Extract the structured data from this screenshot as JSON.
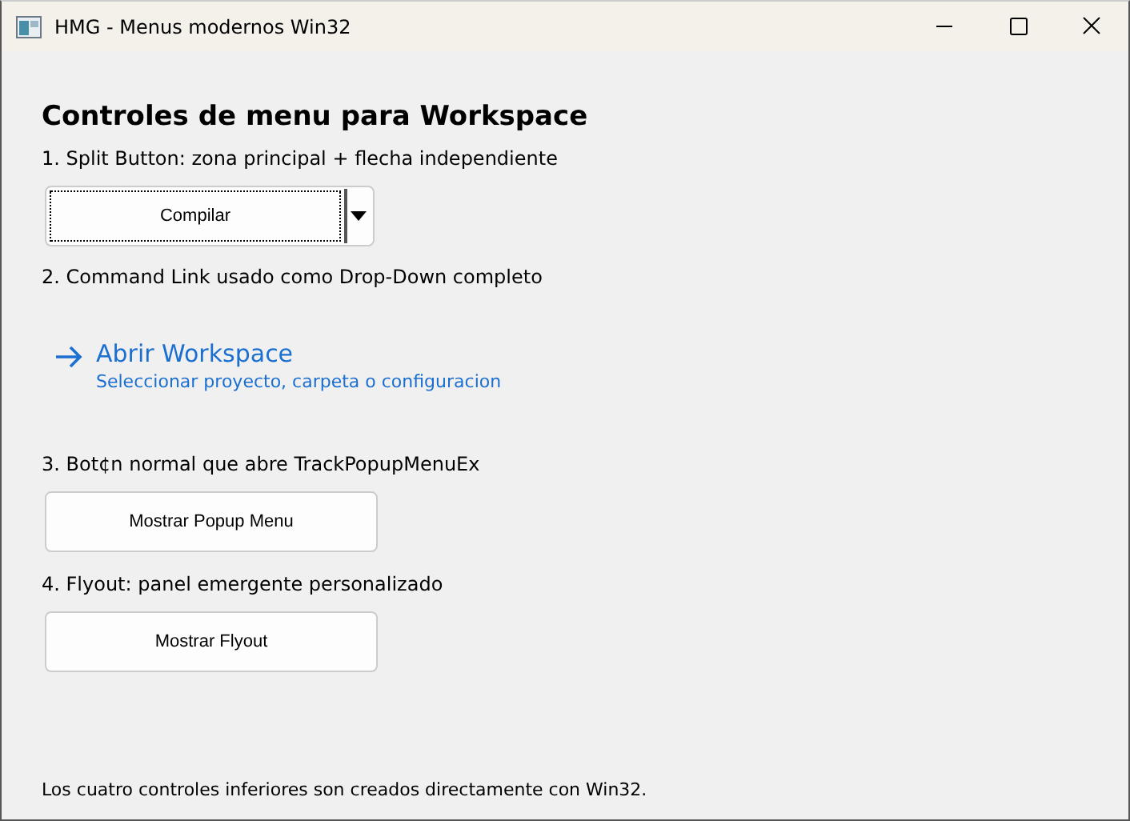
{
  "window": {
    "title": "HMG - Menus modernos Win32"
  },
  "heading": "Controles de menu para Workspace",
  "sections": [
    {
      "label": "1. Split Button: zona principal + flecha independiente",
      "kind": "split",
      "button": "Compilar",
      "focused": true
    },
    {
      "label": "2. Command Link usado como Drop-Down completo",
      "kind": "commandlink",
      "button": "Abrir Workspace",
      "note": "Seleccionar proyecto, carpeta o configuracion"
    },
    {
      "label": "3. Bot¢n normal que abre TrackPopupMenuEx",
      "kind": "button",
      "button": "Mostrar Popup Menu"
    },
    {
      "label": "4. Flyout: panel emergente personalizado",
      "kind": "button",
      "button": "Mostrar Flyout"
    }
  ],
  "footer": "Los cuatro controles inferiores son creados directamente con Win32."
}
